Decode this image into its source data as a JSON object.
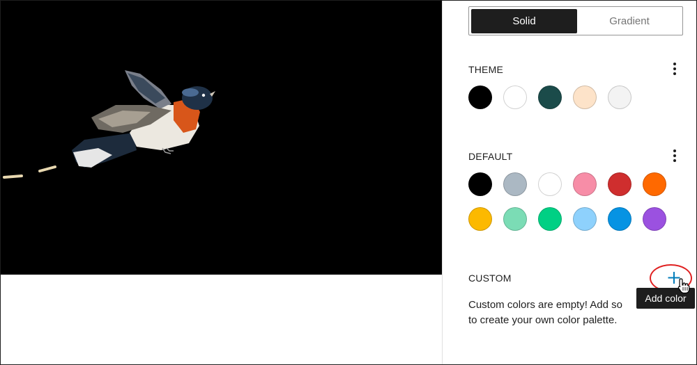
{
  "segmented": {
    "solid": "Solid",
    "gradient": "Gradient",
    "selected": "Solid"
  },
  "theme": {
    "title": "THEME",
    "options_icon": "more-vertical-icon",
    "colors": [
      "#000000",
      "#ffffff",
      "#1b4b4a",
      "#fde3c9",
      "#f3f3f3"
    ]
  },
  "default": {
    "title": "DEFAULT",
    "options_icon": "more-vertical-icon",
    "colors": [
      "#000000",
      "#abb8c3",
      "#ffffff",
      "#f78da7",
      "#cf2e2e",
      "#ff6900",
      "#fcb900",
      "#7bdcb5",
      "#00d084",
      "#8ed1fc",
      "#0693e3",
      "#9b51e0"
    ]
  },
  "custom": {
    "title": "CUSTOM",
    "add_icon": "plus-icon",
    "desc_line1": "Custom colors are empty! Add so",
    "desc_line2": "to create your own color palette.",
    "tooltip": "Add color"
  },
  "accent_color": "#007cba",
  "highlight_color": "#e02020"
}
